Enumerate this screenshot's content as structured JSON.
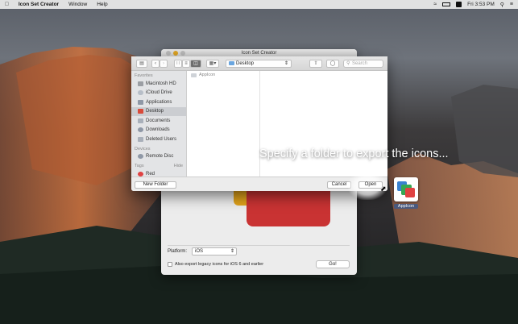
{
  "menubar": {
    "app_name": "Icon Set Creator",
    "menus": [
      "Window",
      "Help"
    ],
    "clock": "Fri 3:53 PM"
  },
  "app_window": {
    "title": "Icon Set Creator",
    "platform_label": "Platform:",
    "platform_value": "iOS",
    "legacy_label": "Also export legacy icons for iOS 6 and earlier",
    "go_label": "Go!"
  },
  "open_panel": {
    "location": "Desktop",
    "search_placeholder": "Search",
    "sidebar": {
      "favorites_header": "Favorites",
      "favorites": [
        "Macintosh HD",
        "iCloud Drive",
        "Applications",
        "Desktop",
        "Documents",
        "Downloads",
        "Deleted Users"
      ],
      "devices_header": "Devices",
      "devices": [
        "Remote Disc"
      ],
      "tags_header": "Tags",
      "tags_hide": "Hide",
      "tags": [
        "Red"
      ]
    },
    "column_items": [
      "AppIcon"
    ],
    "new_folder_label": "New Folder",
    "cancel_label": "Cancel",
    "open_label": "Open"
  },
  "caption": "Specify a folder to export the icons...",
  "desktop_icon": {
    "label": "AppIcon"
  },
  "colors": {
    "accent": "#3b82d0",
    "red": "#c93333",
    "yellow": "#e0a21b"
  }
}
